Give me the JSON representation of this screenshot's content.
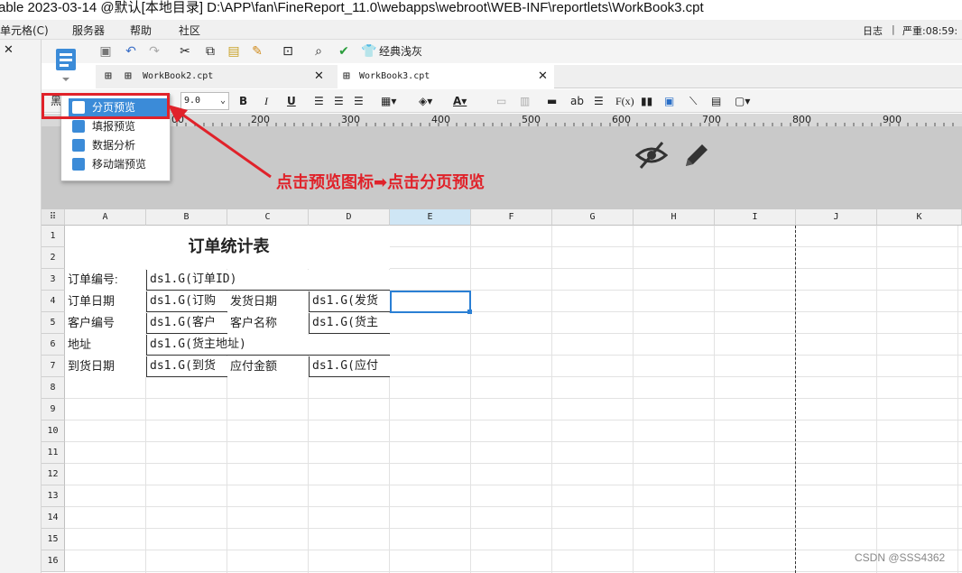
{
  "titlebar": {
    "text": "able 2023-03-14 @默认[本地目录]    D:\\APP\\fan\\FineReport_11.0\\webapps\\webroot\\WEB-INF\\reportlets\\WorkBook3.cpt"
  },
  "menubar": {
    "items": [
      "单元格(C)",
      "服务器",
      "帮助",
      "社区"
    ],
    "log_label": "日志",
    "severity_label": "严重:08:59:"
  },
  "toolbar": {
    "theme_label": "经典浅灰"
  },
  "tabs": [
    {
      "label": "WorkBook2.cpt"
    },
    {
      "label": "WorkBook3.cpt"
    }
  ],
  "format_bar": {
    "font_name": "黑",
    "font_size": "9.0",
    "bold": "B",
    "italic": "I",
    "underline": "U",
    "text_label": "ab",
    "formula_label": "F(x)"
  },
  "preview_menu": {
    "items": [
      {
        "label": "分页预览",
        "selected": true,
        "icon": "page-preview-icon"
      },
      {
        "label": "填报预览",
        "selected": false,
        "icon": "fill-preview-icon"
      },
      {
        "label": "数据分析",
        "selected": false,
        "icon": "data-analysis-icon"
      },
      {
        "label": "移动端预览",
        "selected": false,
        "icon": "mobile-preview-icon"
      }
    ]
  },
  "ruler": {
    "labels": [
      "00",
      "200",
      "300",
      "400",
      "500",
      "600",
      "700",
      "800",
      "900"
    ]
  },
  "annotation": {
    "text": "点击预览图标➡点击分页预览"
  },
  "sheet": {
    "columns": [
      "A",
      "B",
      "C",
      "D",
      "E",
      "F",
      "G",
      "H",
      "I",
      "J",
      "K"
    ],
    "rows": [
      "1",
      "2",
      "3",
      "4",
      "5",
      "6",
      "7",
      "8",
      "9",
      "10",
      "11",
      "12",
      "13",
      "14",
      "15",
      "16"
    ],
    "title": "订单统计表",
    "cells": {
      "a3": "订单编号:",
      "b3": "ds1.G(订单ID)",
      "a4": "订单日期",
      "b4": "ds1.G(订购",
      "c4": "发货日期",
      "d4": "ds1.G(发货",
      "a5": "客户编号",
      "b5": "ds1.G(客户",
      "c5": "客户名称",
      "d5": "ds1.G(货主",
      "a6": "地址",
      "b6": "ds1.G(货主地址)",
      "a7": "到货日期",
      "b7": "ds1.G(到货",
      "c7": "应付金额",
      "d7": "ds1.G(应付"
    }
  },
  "watermark": "CSDN @SSS4362",
  "colors": {
    "accent": "#3b8bd8",
    "annotation_red": "#e0222a",
    "selected_menu": "#3b8bd8"
  }
}
